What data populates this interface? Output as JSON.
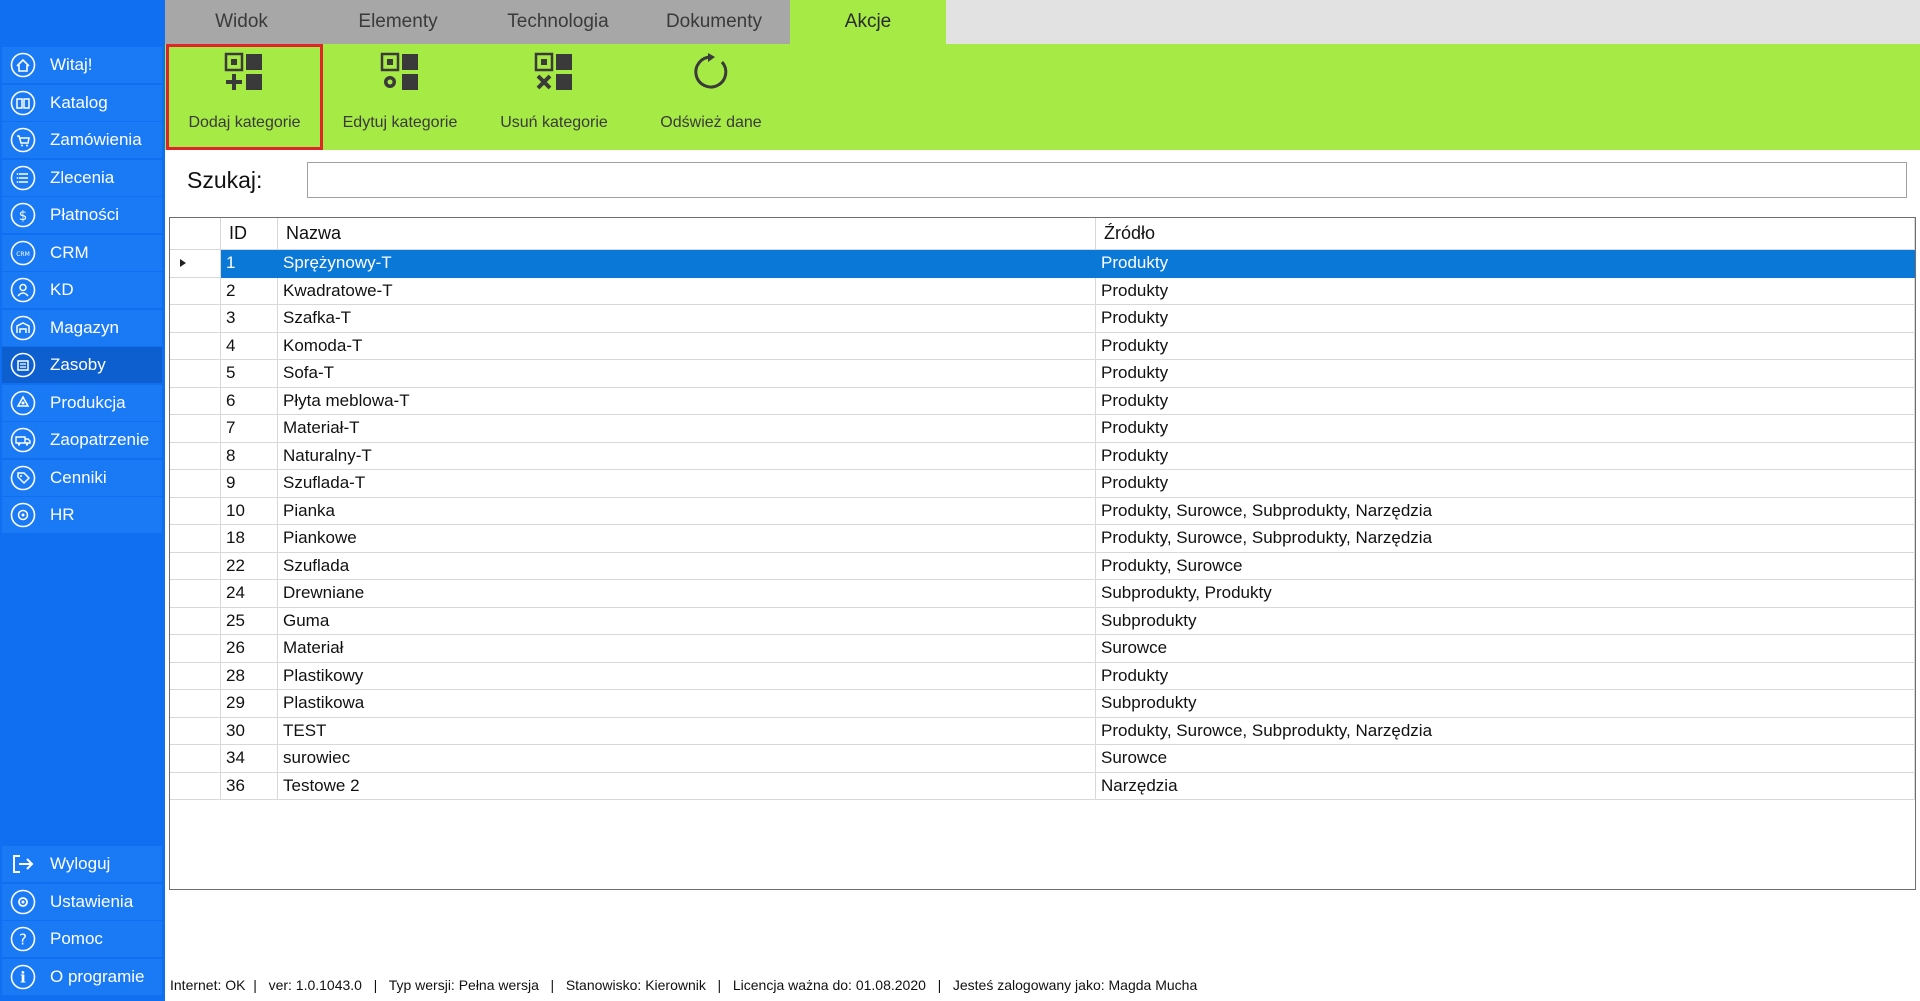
{
  "sidebar": {
    "items": [
      {
        "label": "Witaj!",
        "icon": "home-icon"
      },
      {
        "label": "Katalog",
        "icon": "book-icon"
      },
      {
        "label": "Zamówienia",
        "icon": "cart-icon"
      },
      {
        "label": "Zlecenia",
        "icon": "list-icon"
      },
      {
        "label": "Płatności",
        "icon": "dollar-icon"
      },
      {
        "label": "CRM",
        "icon": "crm-icon"
      },
      {
        "label": "KD",
        "icon": "user-icon"
      },
      {
        "label": "Magazyn",
        "icon": "warehouse-icon"
      },
      {
        "label": "Zasoby",
        "icon": "resources-icon"
      },
      {
        "label": "Produkcja",
        "icon": "production-icon"
      },
      {
        "label": "Zaopatrzenie",
        "icon": "truck-icon"
      },
      {
        "label": "Cenniki",
        "icon": "tag-icon"
      },
      {
        "label": "HR",
        "icon": "hr-icon"
      }
    ],
    "bottom": [
      {
        "label": "Wyloguj",
        "icon": "logout-icon"
      },
      {
        "label": "Ustawienia",
        "icon": "gear-icon"
      },
      {
        "label": "Pomoc",
        "icon": "help-icon"
      },
      {
        "label": "O programie",
        "icon": "info-icon"
      }
    ]
  },
  "tabs": [
    "Widok",
    "Elementy",
    "Technologia",
    "Dokumenty",
    "Akcje"
  ],
  "ribbon": {
    "buttons": [
      {
        "label": "Dodaj kategorie",
        "icon": "add-category-icon"
      },
      {
        "label": "Edytuj kategorie",
        "icon": "edit-category-icon"
      },
      {
        "label": "Usuń kategorie",
        "icon": "delete-category-icon"
      },
      {
        "label": "Odśwież dane",
        "icon": "refresh-icon"
      }
    ]
  },
  "search": {
    "label": "Szukaj:",
    "value": ""
  },
  "table": {
    "columns": [
      "ID",
      "Nazwa",
      "Źródło"
    ],
    "rows": [
      [
        "1",
        "Sprężynowy-T",
        "Produkty"
      ],
      [
        "2",
        "Kwadratowe-T",
        "Produkty"
      ],
      [
        "3",
        "Szafka-T",
        "Produkty"
      ],
      [
        "4",
        "Komoda-T",
        "Produkty"
      ],
      [
        "5",
        "Sofa-T",
        "Produkty"
      ],
      [
        "6",
        "Płyta meblowa-T",
        "Produkty"
      ],
      [
        "7",
        "Materiał-T",
        "Produkty"
      ],
      [
        "8",
        "Naturalny-T",
        "Produkty"
      ],
      [
        "9",
        "Szuflada-T",
        "Produkty"
      ],
      [
        "10",
        "Pianka",
        "Produkty, Surowce, Subprodukty, Narzędzia"
      ],
      [
        "18",
        "Piankowe",
        "Produkty, Surowce, Subprodukty, Narzędzia"
      ],
      [
        "22",
        "Szuflada",
        "Produkty, Surowce"
      ],
      [
        "24",
        "Drewniane",
        "Subprodukty, Produkty"
      ],
      [
        "25",
        "Guma",
        "Subprodukty"
      ],
      [
        "26",
        "Materiał",
        "Surowce"
      ],
      [
        "28",
        "Plastikowy",
        "Produkty"
      ],
      [
        "29",
        "Plastikowa",
        "Subprodukty"
      ],
      [
        "30",
        "TEST",
        "Produkty, Surowce, Subprodukty, Narzędzia"
      ],
      [
        "34",
        "surowiec",
        "Surowce"
      ],
      [
        "36",
        "Testowe 2",
        "Narzędzia"
      ]
    ]
  },
  "status": "Internet: OK  |   ver: 1.0.1043.0   |   Typ wersji: Pełna wersja   |   Stanowisko: Kierownik   |   Licencja ważna do: 01.08.2020   |   Jesteś zalogowany jako: Magda Mucha",
  "colors": {
    "sidebar": "#0f6ff0",
    "ribbon": "#a6ea45",
    "selection": "#0a78d7",
    "highlight": "#e0252a"
  }
}
